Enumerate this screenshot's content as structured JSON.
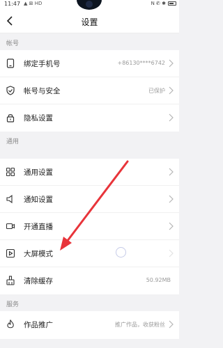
{
  "status_bar": {
    "time": "11:47",
    "left_icons": "▲ ⊠ HD",
    "right_icons": "N ✆ ✱"
  },
  "header": {
    "title": "设置",
    "back_icon": "chevron-left-icon"
  },
  "sections": {
    "account": "帐号",
    "general": "通用",
    "service": "服务"
  },
  "rows": {
    "bind_phone": {
      "label": "绑定手机号",
      "value": "+86130****6742",
      "icon": "phone-icon"
    },
    "account_security": {
      "label": "帐号与安全",
      "value": "已保护",
      "icon": "shield-icon"
    },
    "privacy": {
      "label": "隐私设置",
      "icon": "lock-icon"
    },
    "general_settings": {
      "label": "通用设置",
      "icon": "grid-icon"
    },
    "notification_settings": {
      "label": "通知设置",
      "icon": "speaker-icon"
    },
    "live_stream": {
      "label": "开通直播",
      "icon": "video-camera-icon"
    },
    "big_screen": {
      "label": "大屏模式",
      "icon": "play-screen-icon"
    },
    "clear_cache": {
      "label": "清除缓存",
      "value": "50.92MB",
      "icon": "broom-icon"
    },
    "promote_works": {
      "label": "作品推广",
      "value": "推广作品，收获粉丝",
      "icon": "flame-icon"
    }
  },
  "colors": {
    "annotation_arrow": "#e8343a",
    "background": "#f2f2f4",
    "row_background": "#ffffff"
  }
}
